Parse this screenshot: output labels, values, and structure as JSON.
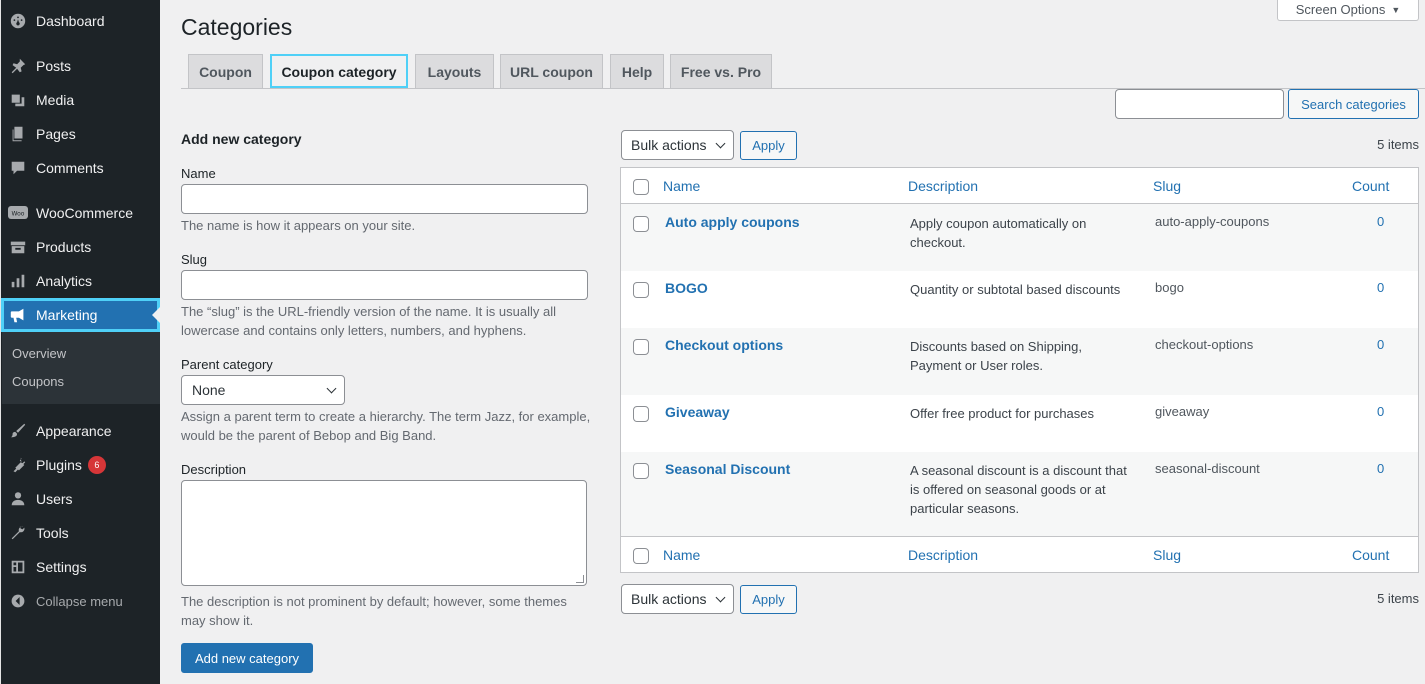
{
  "sidebar": {
    "items": [
      {
        "label": "Dashboard",
        "icon": "dashboard-icon"
      },
      {
        "label": "Posts",
        "icon": "pin-icon"
      },
      {
        "label": "Media",
        "icon": "media-icon"
      },
      {
        "label": "Pages",
        "icon": "pages-icon"
      },
      {
        "label": "Comments",
        "icon": "comments-icon"
      },
      {
        "label": "WooCommerce",
        "icon": "woocommerce-icon"
      },
      {
        "label": "Products",
        "icon": "products-icon"
      },
      {
        "label": "Analytics",
        "icon": "analytics-icon"
      },
      {
        "label": "Marketing",
        "icon": "megaphone-icon"
      },
      {
        "label": "Appearance",
        "icon": "brush-icon"
      },
      {
        "label": "Plugins",
        "icon": "plugins-icon",
        "badge": "6"
      },
      {
        "label": "Users",
        "icon": "users-icon"
      },
      {
        "label": "Tools",
        "icon": "wrench-icon"
      },
      {
        "label": "Settings",
        "icon": "settings-icon"
      }
    ],
    "submenu": [
      "Overview",
      "Coupons"
    ],
    "collapse_label": "Collapse menu"
  },
  "header": {
    "title": "Categories",
    "screen_options": "Screen Options"
  },
  "tabs": [
    "Coupon",
    "Coupon category",
    "Layouts",
    "URL coupon",
    "Help",
    "Free vs. Pro"
  ],
  "search": {
    "value": "",
    "button": "Search categories"
  },
  "form": {
    "heading": "Add new category",
    "name_label": "Name",
    "name_value": "",
    "name_help": "The name is how it appears on your site.",
    "slug_label": "Slug",
    "slug_value": "",
    "slug_help": "The “slug” is the URL-friendly version of the name. It is usually all lowercase and contains only letters, numbers, and hyphens.",
    "parent_label": "Parent category",
    "parent_value": "None",
    "parent_help": "Assign a parent term to create a hierarchy. The term Jazz, for example, would be the parent of Bebop and Big Band.",
    "description_label": "Description",
    "description_value": "",
    "description_help": "The description is not prominent by default; however, some themes may show it.",
    "submit": "Add new category"
  },
  "bulk": {
    "label": "Bulk actions",
    "apply": "Apply",
    "count": "5 items"
  },
  "table": {
    "columns": [
      "Name",
      "Description",
      "Slug",
      "Count"
    ],
    "rows": [
      {
        "name": "Auto apply coupons",
        "description": "Apply coupon automatically on checkout.",
        "slug": "auto-apply-coupons",
        "count": "0"
      },
      {
        "name": "BOGO",
        "description": "Quantity or subtotal based discounts",
        "slug": "bogo",
        "count": "0"
      },
      {
        "name": "Checkout options",
        "description": "Discounts based on Shipping, Payment or User roles.",
        "slug": "checkout-options",
        "count": "0"
      },
      {
        "name": "Giveaway",
        "description": "Offer free product for purchases",
        "slug": "giveaway",
        "count": "0"
      },
      {
        "name": "Seasonal Discount",
        "description": "A seasonal discount is a discount that is offered on seasonal goods or at particular seasons.",
        "slug": "seasonal-discount",
        "count": "0"
      }
    ]
  },
  "colors": {
    "accent": "#2271b1",
    "sidebar_bg": "#1d2327",
    "focus_outline": "#4fd0f7",
    "badge": "#d63638"
  }
}
